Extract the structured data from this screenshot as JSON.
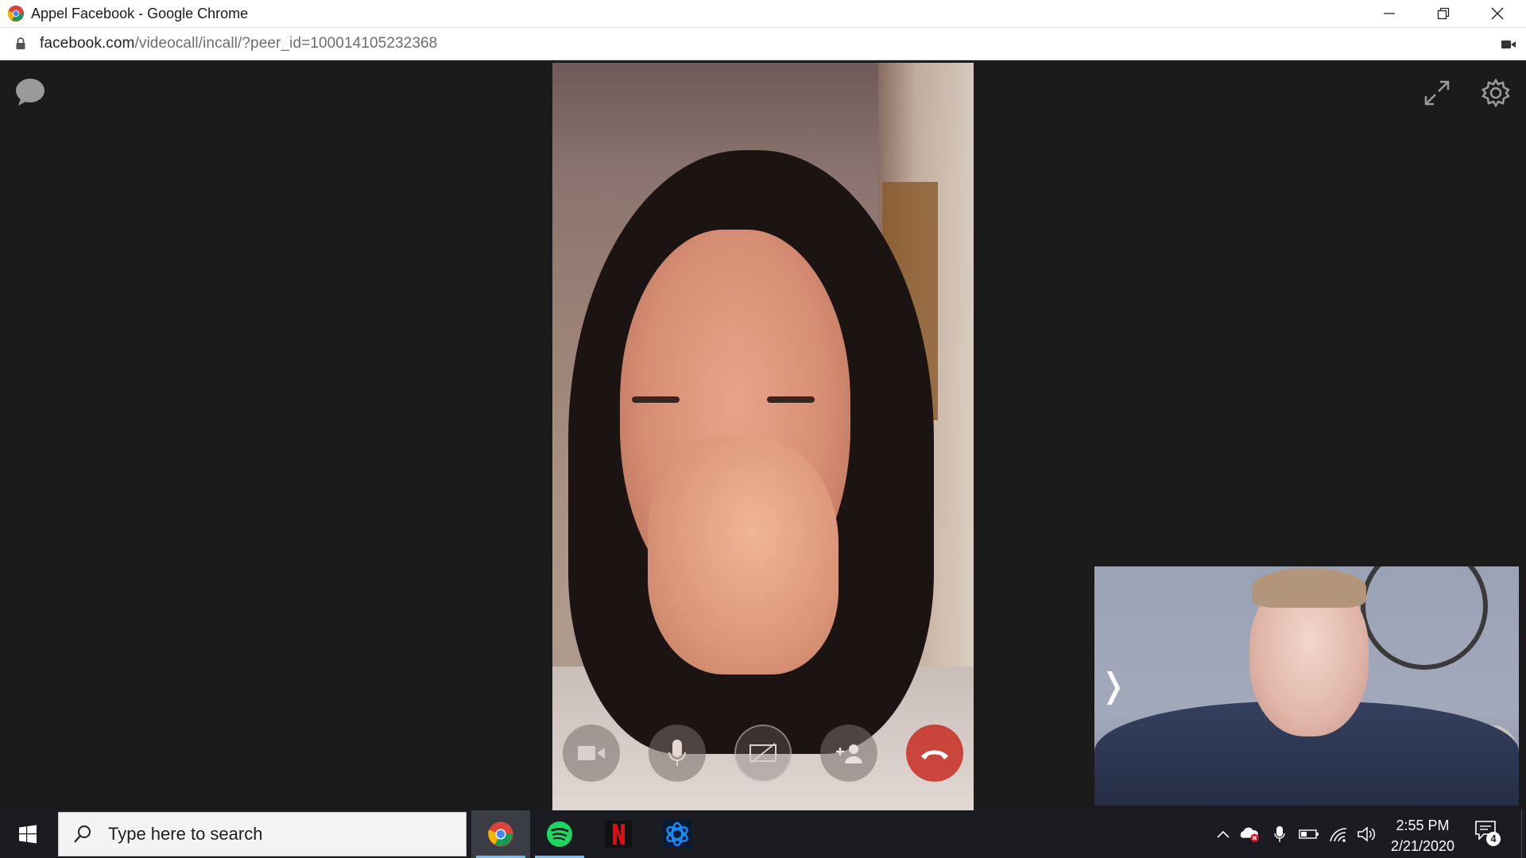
{
  "window": {
    "title": "Appel Facebook - Google Chrome",
    "url_host": "facebook.com",
    "url_path": "/videocall/incall/?peer_id=100014105232368"
  },
  "call": {
    "icons": [
      "chat-icon",
      "expand-icon",
      "settings-icon"
    ],
    "controls": [
      "camera-toggle",
      "mic-toggle",
      "screen-share",
      "add-person",
      "end-call"
    ],
    "hangup_color": "#d03a2c"
  },
  "self_view": {
    "collapse_glyph": "❭"
  },
  "taskbar": {
    "search_placeholder": "Type here to search",
    "apps": [
      "chrome",
      "spotify",
      "netflix",
      "battle-net"
    ],
    "time": "2:55 PM",
    "date": "2/21/2020",
    "notification_count": "4"
  },
  "colors": {
    "taskbar_bg": "#1a1c22",
    "call_bg": "#1b1b1b",
    "spotify_green": "#1ed760",
    "netflix_red": "#e50914",
    "battlenet_blue": "#148eff"
  }
}
